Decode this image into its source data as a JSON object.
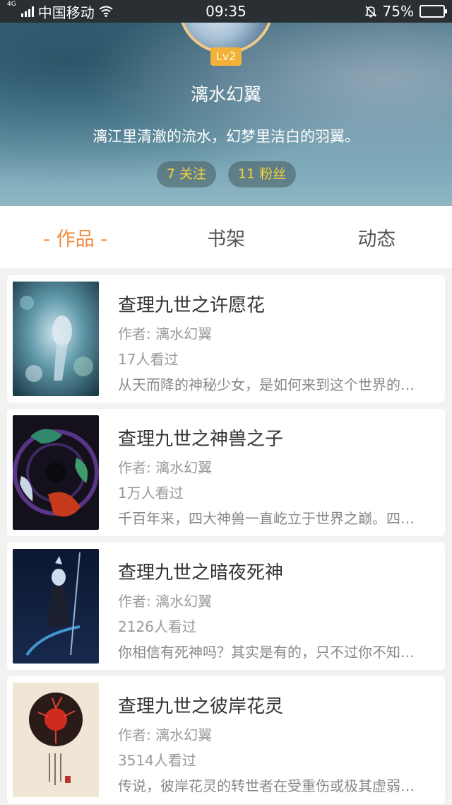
{
  "status_bar": {
    "network_tiny": "4G",
    "carrier": "中国移动",
    "time": "09:35",
    "battery": "75%",
    "battery_level": 0.75
  },
  "profile": {
    "level": "Lv2",
    "name": "漓水幻翼",
    "bio": "漓江里清澈的流水，幻梦里洁白的羽翼。",
    "following": "7 关注",
    "followers": "11 粉丝"
  },
  "tabs": [
    {
      "label": "- 作品 -",
      "active": true
    },
    {
      "label": "书架",
      "active": false
    },
    {
      "label": "动态",
      "active": false
    }
  ],
  "books": [
    {
      "title": "查理九世之许愿花",
      "author": "作者: 漓水幻翼",
      "views": "17人看过",
      "desc": "从天而降的神秘少女，是如何来到这个世界的…"
    },
    {
      "title": "查理九世之神兽之子",
      "author": "作者: 漓水幻翼",
      "views": "1万人看过",
      "desc": "千百年来，四大神兽一直屹立于世界之巅。四…"
    },
    {
      "title": "查理九世之暗夜死神",
      "author": "作者: 漓水幻翼",
      "views": "2126人看过",
      "desc": "你相信有死神吗？其实是有的，只不过你不知…"
    },
    {
      "title": "查理九世之彼岸花灵",
      "author": "作者: 漓水幻翼",
      "views": "3514人看过",
      "desc": "传说，彼岸花灵的转世者在受重伤或极其虚弱…"
    }
  ],
  "colors": {
    "accent": "#f08a3c",
    "badge": "#f2b23a",
    "follow_text": "#f3d23a"
  }
}
